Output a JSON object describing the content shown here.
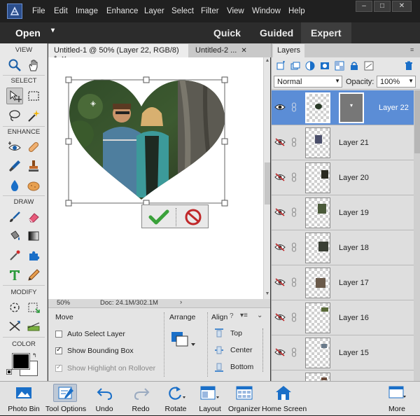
{
  "menu": {
    "items": [
      "File",
      "Edit",
      "Image",
      "Enhance",
      "Layer",
      "Select",
      "Filter",
      "View",
      "Window",
      "Help"
    ]
  },
  "window_controls": {
    "minimize": "–",
    "maximize": "□",
    "close": "✕"
  },
  "modebar": {
    "open_label": "Open",
    "open_arrow": "▾",
    "tabs": [
      {
        "label": "Quick",
        "active": false
      },
      {
        "label": "Guided",
        "active": false
      },
      {
        "label": "Expert",
        "active": true
      }
    ]
  },
  "toolbox": {
    "sections": {
      "view": "VIEW",
      "select": "SELECT",
      "enhance": "ENHANCE",
      "draw": "DRAW",
      "modify": "MODIFY",
      "color": "COLOR"
    },
    "tools": [
      {
        "name": "zoom-tool",
        "icon": "magnifier-icon"
      },
      {
        "name": "hand-tool",
        "icon": "hand-icon"
      },
      {
        "name": "move-tool",
        "icon": "move-arrows-icon",
        "selected": true
      },
      {
        "name": "marquee-tool",
        "icon": "dashed-rectangle-icon"
      },
      {
        "name": "lasso-tool",
        "icon": "lasso-icon"
      },
      {
        "name": "magic-wand-tool",
        "icon": "magic-wand-icon"
      },
      {
        "name": "red-eye-tool",
        "icon": "eye-plus-icon"
      },
      {
        "name": "spot-healing-tool",
        "icon": "bandage-icon"
      },
      {
        "name": "smart-brush-tool",
        "icon": "smart-brush-icon"
      },
      {
        "name": "clone-stamp-tool",
        "icon": "stamp-icon"
      },
      {
        "name": "blur-tool",
        "icon": "drop-icon"
      },
      {
        "name": "sponge-tool",
        "icon": "sponge-icon"
      },
      {
        "name": "brush-tool",
        "icon": "brush-icon"
      },
      {
        "name": "eraser-tool",
        "icon": "eraser-icon"
      },
      {
        "name": "paint-bucket-tool",
        "icon": "bucket-icon"
      },
      {
        "name": "gradient-tool",
        "icon": "gradient-icon"
      },
      {
        "name": "eyedropper-tool",
        "icon": "eyedropper-icon"
      },
      {
        "name": "custom-shape-tool",
        "icon": "puzzle-shape-icon"
      },
      {
        "name": "type-tool",
        "icon": "type-t-icon"
      },
      {
        "name": "pencil-tool",
        "icon": "pencil-icon"
      },
      {
        "name": "crop-tool",
        "icon": "crop-icon"
      },
      {
        "name": "recompose-tool",
        "icon": "recompose-icon"
      },
      {
        "name": "content-aware-move-tool",
        "icon": "cross-arrows-icon"
      },
      {
        "name": "straighten-tool",
        "icon": "straighten-icon"
      }
    ],
    "colors": {
      "foreground": "#000000",
      "background": "#ffffff"
    }
  },
  "document_tabs": [
    {
      "label": "Untitled-1 @ 50% (Layer 22, RGB/8) *",
      "close": "✕",
      "active": true
    },
    {
      "label": "Untitled-2 ...",
      "close": "✕",
      "active": false
    }
  ],
  "status_bar": {
    "zoom": "50%",
    "doc_info": "Doc: 24.1M/302.1M",
    "arrow": "›"
  },
  "tool_options": {
    "title": "Move",
    "auto_select_layer": {
      "label": "Auto Select Layer",
      "checked": false
    },
    "show_bounding_box": {
      "label": "Show Bounding Box",
      "checked": true
    },
    "show_highlight": {
      "label": "Show Highlight on Rollover",
      "checked": true,
      "disabled": true
    },
    "arrange_label": "Arrange",
    "align_label": "Align",
    "align": {
      "top": "Top",
      "center": "Center",
      "bottom": "Bottom"
    }
  },
  "layers_panel": {
    "tab_label": "Layers",
    "blend_mode": "Normal",
    "opacity_label": "Opacity:",
    "opacity_value": "100%",
    "layers": [
      {
        "name": "Layer 22",
        "visible": true,
        "selected": true
      },
      {
        "name": "Layer 21",
        "visible": false,
        "selected": false
      },
      {
        "name": "Layer 20",
        "visible": false,
        "selected": false
      },
      {
        "name": "Layer 19",
        "visible": false,
        "selected": false
      },
      {
        "name": "Layer 18",
        "visible": false,
        "selected": false
      },
      {
        "name": "Layer 17",
        "visible": false,
        "selected": false
      },
      {
        "name": "Layer 16",
        "visible": false,
        "selected": false
      },
      {
        "name": "Layer 15",
        "visible": false,
        "selected": false
      }
    ]
  },
  "taskbar": [
    {
      "label": "Photo Bin",
      "icon": "photo-bin-icon",
      "active": false
    },
    {
      "label": "Tool Options",
      "icon": "tool-options-icon",
      "active": true
    },
    {
      "label": "Undo",
      "icon": "undo-icon",
      "active": false
    },
    {
      "label": "Redo",
      "icon": "redo-icon",
      "active": false
    },
    {
      "label": "Rotate",
      "icon": "rotate-icon",
      "active": false
    },
    {
      "label": "Layout",
      "icon": "layout-icon",
      "active": false
    },
    {
      "label": "Organizer",
      "icon": "organizer-icon",
      "active": false
    },
    {
      "label": "Home Screen",
      "icon": "home-icon",
      "active": false
    },
    {
      "label": "More",
      "icon": "more-icon",
      "active": false
    }
  ],
  "colors": {
    "accent_selected_layer": "#5b8dd6",
    "commit_green": "#3aa13a",
    "cancel_red": "#c0282a"
  }
}
